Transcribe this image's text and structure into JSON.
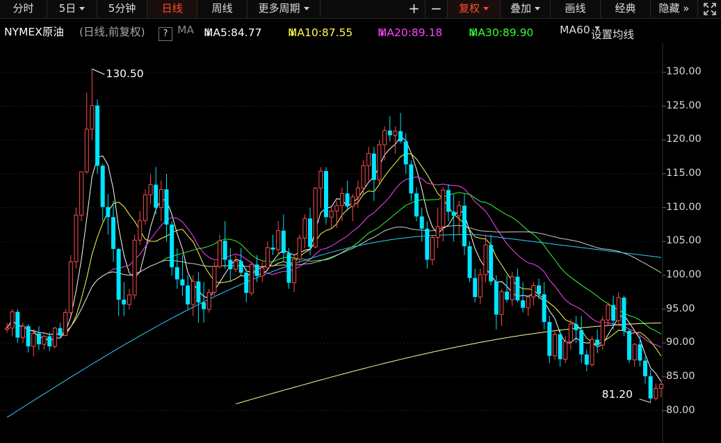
{
  "toolbar": {
    "intraday": "分时",
    "five_day": "5日",
    "five_min": "5分钟",
    "daily": "日线",
    "weekly": "周线",
    "more_periods": "更多周期",
    "zoom_in": "+",
    "zoom_out": "−",
    "adjust": "复权",
    "overlay": "叠加",
    "draw": "画线",
    "classic": "经典",
    "hide": "隐藏",
    "hide_arrows": "»",
    "fullscreen_icon": "expand-icon"
  },
  "info": {
    "symbol": "NYMEX原油",
    "mode": "(日线,前复权)",
    "help": "?",
    "ma_label": "MA",
    "ma5": "MA5:84.77",
    "ma10": "MA10:87.55",
    "ma20": "MA20:89.18",
    "ma30": "MA30:89.90",
    "ma60": "MA60",
    "settings": "设置均线",
    "down_arrow": "↓"
  },
  "colors": {
    "up": "#ff4d4d",
    "down": "#00e5ff",
    "ma5": "#ffffff",
    "ma10": "#ffff4d",
    "ma20": "#ff44ff",
    "ma30": "#33ff33",
    "ma60": "#cccccc",
    "ma120": "#33ccff",
    "ma250": "#ffff99",
    "active": "#ff4c2e"
  },
  "chart_data": {
    "type": "candlestick",
    "y_ticks": [
      "130.00",
      "125.00",
      "120.00",
      "115.00",
      "110.00",
      "105.00",
      "100.00",
      "95.00",
      "90.00",
      "85.00",
      "80.00"
    ],
    "ylim": [
      78,
      135
    ],
    "high_label": "130.50",
    "low_label": "81.20",
    "high_value": 130.5,
    "low_value": 81.2,
    "candles": [
      [
        92,
        93,
        91.5,
        92.2
      ],
      [
        92.2,
        95,
        91,
        94.6
      ],
      [
        94.6,
        95,
        90,
        90.8
      ],
      [
        90.8,
        93,
        90,
        92.5
      ],
      [
        92.5,
        92.8,
        88.6,
        89.5
      ],
      [
        89.5,
        92,
        88,
        91.4
      ],
      [
        91.4,
        92.5,
        89,
        89.8
      ],
      [
        89.8,
        91.2,
        89,
        91
      ],
      [
        91,
        91.6,
        88.8,
        89.5
      ],
      [
        89.5,
        92.4,
        89.2,
        92.2
      ],
      [
        92.2,
        93,
        90.7,
        91.1
      ],
      [
        91.1,
        95,
        91,
        94.5
      ],
      [
        94.5,
        103,
        94,
        102
      ],
      [
        102,
        110,
        101,
        108.9
      ],
      [
        108.9,
        115,
        108,
        115.3
      ],
      [
        115.3,
        127,
        115,
        121.6
      ],
      [
        121.6,
        130.5,
        120,
        125.1
      ],
      [
        125.1,
        126,
        115,
        116.2
      ],
      [
        116.2,
        116.5,
        108,
        110.1
      ],
      [
        110.1,
        112,
        106,
        108.6
      ],
      [
        108.6,
        111,
        102,
        103.9
      ],
      [
        103.9,
        104,
        94,
        96.4
      ],
      [
        96.4,
        99,
        94,
        95.7
      ],
      [
        95.7,
        98,
        95,
        97.1
      ],
      [
        97.1,
        106,
        96.5,
        105.2
      ],
      [
        105.2,
        109.5,
        104.5,
        108.1
      ],
      [
        108.1,
        112.7,
        107.5,
        111.9
      ],
      [
        111.9,
        115,
        110.5,
        113.4
      ],
      [
        113.4,
        116,
        109,
        110
      ],
      [
        110,
        114,
        108,
        112.7
      ],
      [
        112.7,
        115,
        105,
        107.5
      ],
      [
        107.5,
        108,
        100,
        101.2
      ],
      [
        101.2,
        104,
        98,
        99.4
      ],
      [
        99.4,
        103,
        97,
        98.5
      ],
      [
        98.5,
        100,
        95,
        95.7
      ],
      [
        95.7,
        100,
        94,
        99.1
      ],
      [
        99.1,
        100.5,
        93,
        96
      ],
      [
        96,
        99,
        93,
        95
      ],
      [
        95,
        98,
        94.5,
        97.5
      ],
      [
        97.5,
        102,
        97,
        101.3
      ],
      [
        101.3,
        106,
        101,
        105.1
      ],
      [
        105.1,
        108,
        101,
        102.3
      ],
      [
        102.3,
        104,
        99,
        100.9
      ],
      [
        100.9,
        103,
        100.5,
        102.1
      ],
      [
        102.1,
        104,
        100,
        100.4
      ],
      [
        100.4,
        101,
        96,
        97.4
      ],
      [
        97.4,
        102,
        97,
        101.6
      ],
      [
        101.6,
        103,
        99,
        99.9
      ],
      [
        99.9,
        102,
        99,
        101.1
      ],
      [
        101.1,
        105,
        101,
        104.1
      ],
      [
        104.1,
        106,
        103,
        103.8
      ],
      [
        103.8,
        108,
        103,
        106.6
      ],
      [
        106.6,
        109,
        102,
        103.3
      ],
      [
        103.3,
        104,
        98,
        98.9
      ],
      [
        98.9,
        103,
        97.5,
        102.4
      ],
      [
        102.4,
        106,
        102,
        105.5
      ],
      [
        105.5,
        109,
        104,
        108.4
      ],
      [
        108.4,
        110,
        103,
        104.2
      ],
      [
        104.2,
        113,
        104,
        112.9
      ],
      [
        112.9,
        116,
        110,
        115.4
      ],
      [
        115.4,
        116,
        107.5,
        108.6
      ],
      [
        108.6,
        110,
        107,
        109.5
      ],
      [
        109.5,
        111,
        107,
        110.3
      ],
      [
        110.3,
        113,
        108,
        112.1
      ],
      [
        112.1,
        114,
        109.5,
        110.2
      ],
      [
        110.2,
        112,
        108,
        111.6
      ],
      [
        111.6,
        114,
        110,
        112.9
      ],
      [
        112.9,
        117,
        112,
        116.2
      ],
      [
        116.2,
        119,
        114,
        118
      ],
      [
        118,
        119,
        111,
        114.1
      ],
      [
        114.1,
        120,
        113.5,
        119.3
      ],
      [
        119.3,
        122,
        117,
        121.4
      ],
      [
        121.4,
        123.5,
        119.8,
        120.7
      ],
      [
        120.7,
        122,
        118,
        121.3
      ],
      [
        121.3,
        124,
        119.5,
        119.8
      ],
      [
        119.8,
        121,
        115,
        116.4
      ],
      [
        116.4,
        117,
        111,
        112.1
      ],
      [
        112.1,
        113,
        108,
        108.7
      ],
      [
        108.7,
        110,
        105,
        106.9
      ],
      [
        106.9,
        108,
        101,
        102.3
      ],
      [
        102.3,
        106,
        101.5,
        105.6
      ],
      [
        105.6,
        110,
        104,
        107.2
      ],
      [
        107.2,
        113,
        105,
        112.6
      ],
      [
        112.6,
        113.5,
        108,
        109.4
      ],
      [
        109.4,
        112,
        105,
        108.8
      ],
      [
        108.8,
        111,
        106,
        110.3
      ],
      [
        110.3,
        112,
        103,
        104.3
      ],
      [
        104.3,
        105,
        99,
        99.6
      ],
      [
        99.6,
        101,
        96,
        96.8
      ],
      [
        96.8,
        101,
        95.8,
        100.1
      ],
      [
        100.1,
        106,
        99,
        104.5
      ],
      [
        104.5,
        106,
        98.5,
        99.1
      ],
      [
        99.1,
        100,
        92,
        94.2
      ],
      [
        94.2,
        98,
        92.5,
        97.6
      ],
      [
        97.6,
        100,
        96,
        96.4
      ],
      [
        96.4,
        100.5,
        95.5,
        99.8
      ],
      [
        99.8,
        101,
        96,
        96.3
      ],
      [
        96.3,
        99,
        94.5,
        95.2
      ],
      [
        95.2,
        97,
        94,
        96.8
      ],
      [
        96.8,
        99,
        95.5,
        98.5
      ],
      [
        98.5,
        99.5,
        96.5,
        97.2
      ],
      [
        97.2,
        99,
        92,
        93.1
      ],
      [
        93.1,
        94,
        87,
        88.1
      ],
      [
        88.1,
        92,
        87.5,
        91.3
      ],
      [
        91.3,
        92,
        86.5,
        87.6
      ],
      [
        87.6,
        91,
        87,
        90.2
      ],
      [
        90.2,
        93.5,
        89,
        92.8
      ],
      [
        92.8,
        94,
        90,
        91.9
      ],
      [
        91.9,
        94,
        87,
        88.3
      ],
      [
        88.3,
        89,
        85.8,
        86.8
      ],
      [
        86.8,
        91,
        86.5,
        90.5
      ],
      [
        90.5,
        92,
        88.5,
        89.7
      ],
      [
        89.7,
        94,
        89,
        93.4
      ],
      [
        93.4,
        96,
        92.5,
        95.6
      ],
      [
        95.6,
        97,
        92,
        93.3
      ],
      [
        93.3,
        97.5,
        92.5,
        96.7
      ],
      [
        96.7,
        97,
        91,
        91.8
      ],
      [
        91.8,
        92,
        87,
        87.5
      ],
      [
        87.5,
        90,
        86.5,
        89.8
      ],
      [
        89.8,
        91,
        86.5,
        87.4
      ],
      [
        87.4,
        88,
        84,
        85.1
      ],
      [
        85.1,
        86,
        81.2,
        81.8
      ],
      [
        81.8,
        84,
        81.5,
        83.3
      ],
      [
        83.3,
        84.5,
        82,
        83.9
      ]
    ]
  }
}
